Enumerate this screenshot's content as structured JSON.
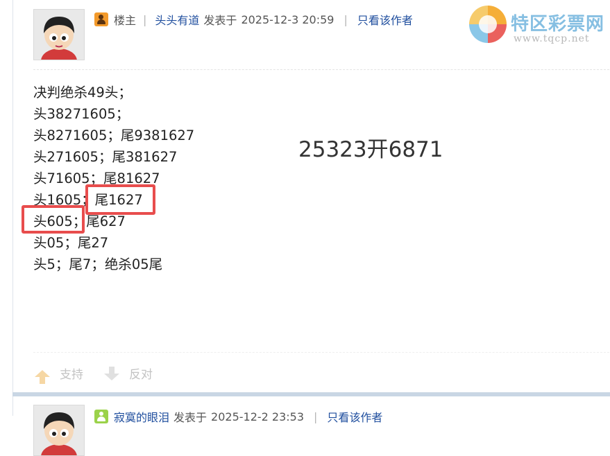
{
  "post1": {
    "role_label": "楼主",
    "author": "头头有道",
    "posted_prefix": "发表于",
    "posted_time": "2025-12-3 20:59",
    "only_author": "只看该作者",
    "content_lines": [
      "决判绝杀49头；",
      "头38271605；",
      "头8271605；尾9381627",
      "头271605；尾381627",
      "头71605；尾81627",
      "头1605；尾1627",
      "头605；尾627",
      "头05；尾27",
      "头5；尾7；绝杀05尾"
    ],
    "result_text": "25323开6871",
    "support_label": "支持",
    "oppose_label": "反对"
  },
  "watermark": {
    "title": "特区彩票网",
    "url": "www.tqcp.net"
  },
  "post2": {
    "author": "寂寞的眼泪",
    "posted_prefix": "发表于",
    "posted_time": "2025-12-2 23:53",
    "only_author": "只看该作者"
  },
  "colors": {
    "link": "#1f4e9e",
    "highlight_border": "#e84d4d",
    "separator": "#c9d6e4"
  }
}
